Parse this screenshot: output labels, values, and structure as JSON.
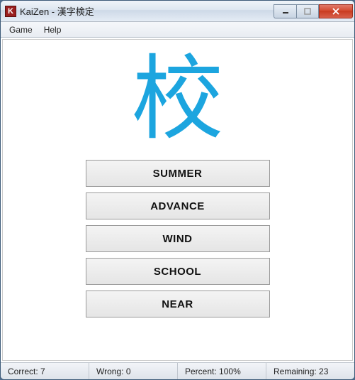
{
  "window": {
    "app_icon_letter": "K",
    "title": "KaiZen - 漢字検定"
  },
  "menu": {
    "game": "Game",
    "help": "Help"
  },
  "quiz": {
    "kanji": "校",
    "answers": [
      "SUMMER",
      "ADVANCE",
      "WIND",
      "SCHOOL",
      "NEAR"
    ]
  },
  "status": {
    "correct_label": "Correct:",
    "correct_value": "7",
    "wrong_label": "Wrong:",
    "wrong_value": "0",
    "percent_label": "Percent:",
    "percent_value": "100%",
    "remaining_label": "Remaining:",
    "remaining_value": "23"
  }
}
